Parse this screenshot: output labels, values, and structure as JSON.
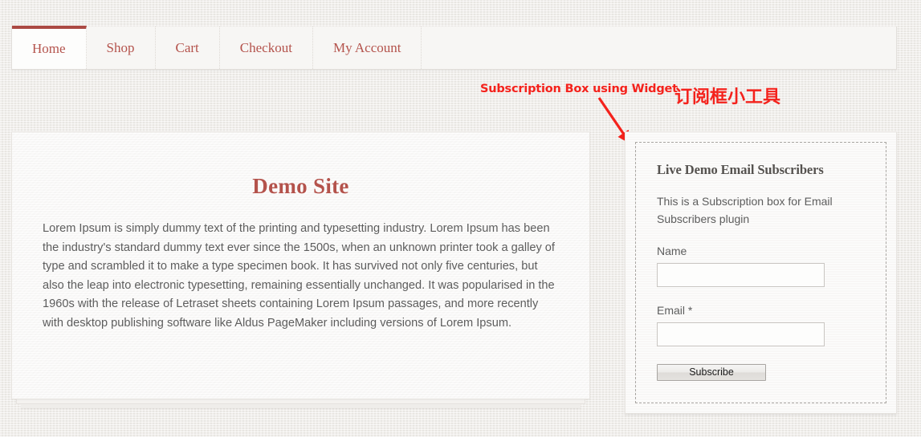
{
  "nav": {
    "items": [
      {
        "label": "Home",
        "active": true
      },
      {
        "label": "Shop",
        "active": false
      },
      {
        "label": "Cart",
        "active": false
      },
      {
        "label": "Checkout",
        "active": false
      },
      {
        "label": "My Account",
        "active": false
      }
    ],
    "active_accent_color": "#ab4a44",
    "link_color": "#b4534c"
  },
  "main": {
    "title": "Demo Site",
    "paragraph": "Lorem Ipsum is simply dummy text of the printing and typesetting industry. Lorem Ipsum has been the industry's standard dummy text ever since the 1500s, when an unknown printer took a galley of type and scrambled it to make a type specimen book. It has survived not only five centuries, but also the leap into electronic typesetting, remaining essentially unchanged. It was popularised in the 1960s with the release of Letraset sheets containing Lorem Ipsum passages, and more recently with desktop publishing software like Aldus PageMaker including versions of Lorem Ipsum."
  },
  "widget": {
    "title": "Live Demo Email Subscribers",
    "description": "This is a Subscription box for Email Subscribers plugin",
    "fields": [
      {
        "label": "Name",
        "value": "",
        "placeholder": ""
      },
      {
        "label": "Email *",
        "value": "",
        "placeholder": ""
      }
    ],
    "submit_label": "Subscribe"
  },
  "annotations": {
    "english": "Subscription Box using Widget",
    "chinese": "订阅框小工具",
    "color": "#f4221c",
    "arrow": "arrow-down-right-icon"
  }
}
